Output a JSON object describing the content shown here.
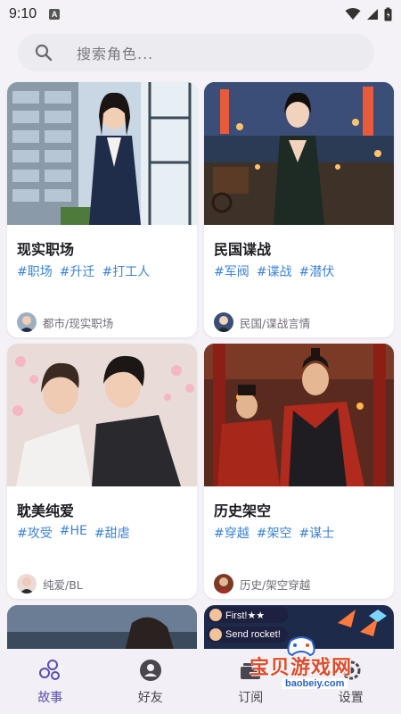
{
  "status_bar": {
    "time": "9:10",
    "notif": "A"
  },
  "search": {
    "placeholder": "搜索角色..."
  },
  "cards": [
    {
      "title": "现实职场",
      "tags": [
        "#职场",
        "#升迁",
        "#打工人"
      ],
      "category": "都市/现实职场"
    },
    {
      "title": "民国谍战",
      "tags": [
        "#军阀",
        "#谍战",
        "#潜伏"
      ],
      "category": "民国/谍战言情"
    },
    {
      "title": "耽美纯爱",
      "tags": [
        "#攻受",
        "#HE",
        "#甜虐"
      ],
      "category": "纯爱/BL"
    },
    {
      "title": "历史架空",
      "tags": [
        "#穿越",
        "#架空",
        "#谋士"
      ],
      "category": "历史/架空穿越"
    }
  ],
  "overlay": {
    "line1": "First!★★",
    "line2": "Send rocket!"
  },
  "nav": [
    {
      "label": "故事",
      "icon": "story-bubbles-icon",
      "active": true
    },
    {
      "label": "好友",
      "icon": "person-icon",
      "active": false
    },
    {
      "label": "订阅",
      "icon": "subscribe-icon",
      "active": false
    },
    {
      "label": "设置",
      "icon": "settings-icon",
      "active": false
    }
  ],
  "watermark": {
    "text": "宝贝游戏网",
    "url": "baobeiy.com"
  },
  "colors": {
    "accent": "#5a4eb0",
    "tag": "#3b83d8",
    "background": "#f4f2f7"
  }
}
